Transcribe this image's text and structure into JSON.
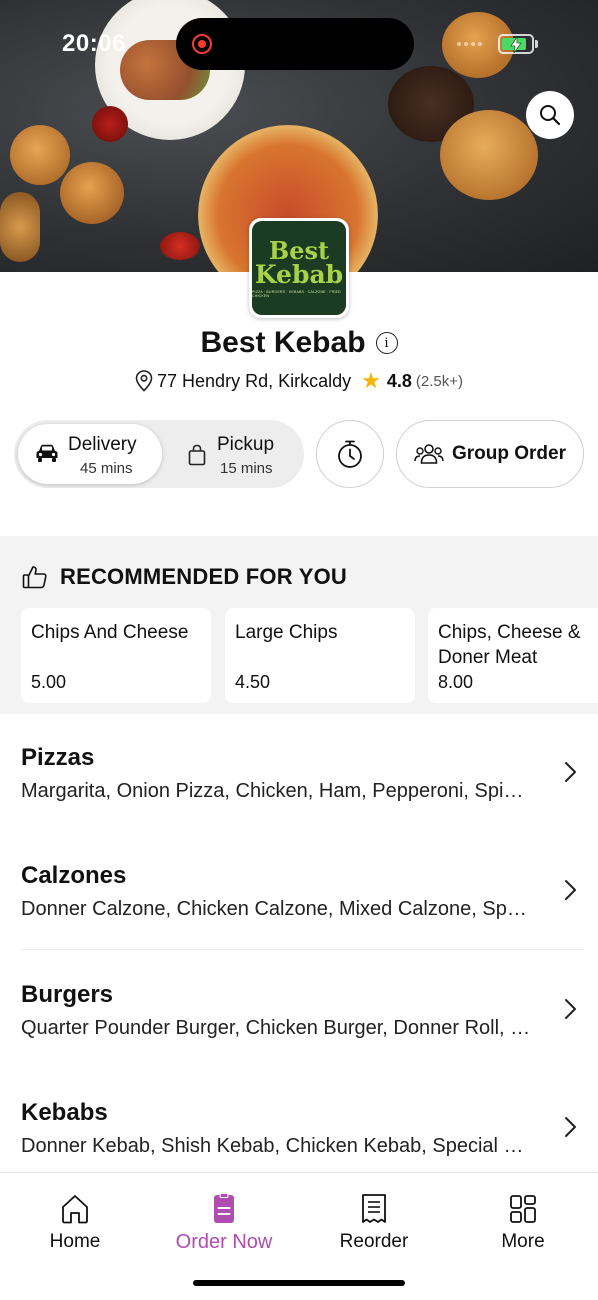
{
  "status_bar": {
    "time": "20:06"
  },
  "restaurant": {
    "name": "Best Kebab",
    "logo": {
      "line1": "Best",
      "line2": "Kebab",
      "tagline": "PIZZA · BURGERS · KEBABS · CALZONE · FRIED CHICKEN"
    },
    "address": "77 Hendry Rd, Kirkcaldy",
    "rating": "4.8",
    "rating_count": "(2.5k+)"
  },
  "order_modes": {
    "delivery": {
      "label": "Delivery",
      "time": "45 mins"
    },
    "pickup": {
      "label": "Pickup",
      "time": "15 mins"
    }
  },
  "actions": {
    "group_order": "Group Order"
  },
  "recommended": {
    "title": "RECOMMENDED FOR YOU",
    "items": [
      {
        "name": "Chips And Cheese",
        "price": "5.00"
      },
      {
        "name": "Large Chips",
        "price": "4.50"
      },
      {
        "name": "Chips, Cheese & Doner Meat",
        "price": "8.00"
      }
    ]
  },
  "categories": [
    {
      "name": "Pizzas",
      "items": "Margarita, Onion Pizza, Chicken, Ham, Pepperoni, Spicy Chicken"
    },
    {
      "name": "Calzones",
      "items": "Donner Calzone, Chicken Calzone, Mixed Calzone, Special Calzone"
    },
    {
      "name": "Burgers",
      "items": "Quarter Pounder Burger, Chicken Burger, Donner Roll, Cheese Burger"
    },
    {
      "name": "Kebabs",
      "items": "Donner Kebab, Shish Kebab, Chicken Kebab, Special Kebab"
    }
  ],
  "tabs": [
    {
      "label": "Home",
      "icon": "home-icon"
    },
    {
      "label": "Order Now",
      "icon": "order-icon",
      "active": true
    },
    {
      "label": "Reorder",
      "icon": "receipt-icon"
    },
    {
      "label": "More",
      "icon": "grid-icon"
    }
  ],
  "colors": {
    "accent": "#b04db0",
    "star": "#f5b400",
    "logo_bg": "#1b3b22",
    "logo_text": "#a8d24a"
  }
}
